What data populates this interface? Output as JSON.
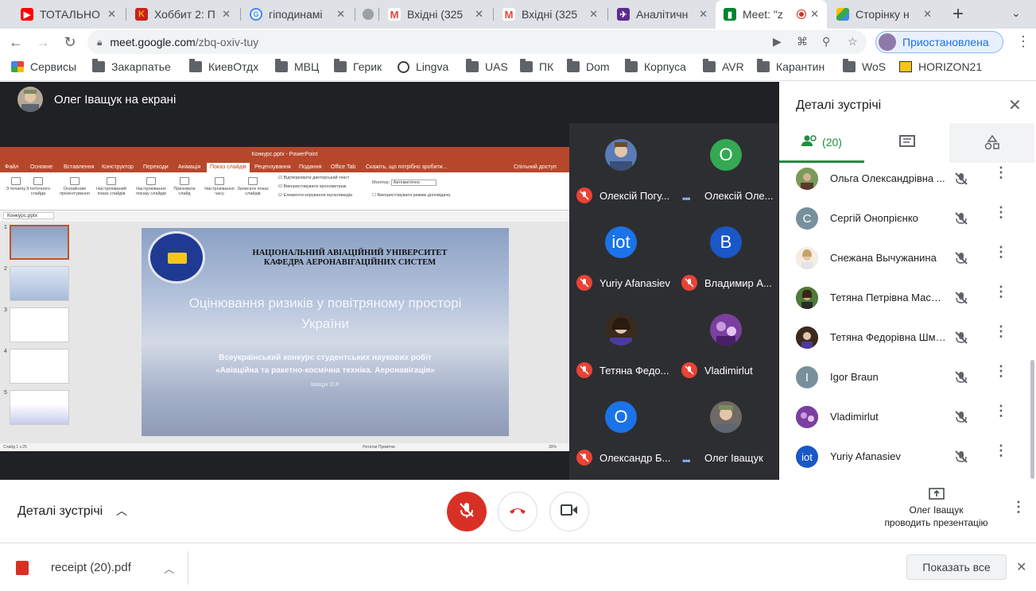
{
  "browser": {
    "tabs": [
      {
        "title": "ТОТАЛЬНО",
        "favicon": "youtube-icon",
        "color": "#ff0000"
      },
      {
        "title": "Хоббит 2: П",
        "favicon": "k-icon",
        "color": "#e8710a"
      },
      {
        "title": "гіподинамі",
        "favicon": "google-icon",
        "color": "#4285f4"
      },
      {
        "title": "",
        "favicon": "loading-icon",
        "color": "#9aa0a6"
      },
      {
        "title": "Вхідні (325",
        "favicon": "gmail-icon",
        "color": "#ea4335"
      },
      {
        "title": "Вхідні (325",
        "favicon": "gmail-icon",
        "color": "#ea4335"
      },
      {
        "title": "Аналітичн",
        "favicon": "plane-icon",
        "color": "#5b2a8f"
      },
      {
        "title": "Meet: \"z",
        "favicon": "meet-icon",
        "color": "#00832d",
        "active": true
      },
      {
        "title": "Сторінку н",
        "favicon": "drive-icon",
        "color": "#fbbc04"
      }
    ],
    "url_host": "meet.google.com",
    "url_path": "/zbq-oxiv-tuy",
    "profile_label": "Приостановлена",
    "bookmarks": [
      {
        "label": "Сервисы",
        "icon": "apps-icon"
      },
      {
        "label": "Закарпатье",
        "icon": "folder-icon"
      },
      {
        "label": "КиевОтдх",
        "icon": "folder-icon"
      },
      {
        "label": "МВЦ",
        "icon": "folder-icon"
      },
      {
        "label": "Герик",
        "icon": "folder-icon"
      },
      {
        "label": "Lingva",
        "icon": "globe-icon"
      },
      {
        "label": "UAS",
        "icon": "folder-icon"
      },
      {
        "label": "ПК",
        "icon": "folder-icon"
      },
      {
        "label": "Dom",
        "icon": "folder-icon"
      },
      {
        "label": "Корпуса",
        "icon": "folder-icon"
      },
      {
        "label": "AVR",
        "icon": "folder-icon"
      },
      {
        "label": "Карантин",
        "icon": "folder-icon"
      },
      {
        "label": "WoS",
        "icon": "folder-icon"
      },
      {
        "label": "HORIZON21",
        "icon": "horizon-icon"
      }
    ]
  },
  "meet": {
    "presenter_label": "Олег Іващук на екрані",
    "ppt": {
      "window_title": "Конкурс.pptx - PowerPoint",
      "menu": [
        "Файл",
        "Основне",
        "Вставлення",
        "Конструктор",
        "Переходи",
        "Анімація",
        "Показ слайдів",
        "Рецензування",
        "Подання",
        "Office Tab",
        "Скажіть, що потрібно зробити...",
        "Спільний доступ"
      ],
      "ribbon": [
        "З початку",
        "З поточного слайда",
        "Онлайнове презентування",
        "Настроюваний показ слайдів",
        "Настроювання показу слайдів",
        "Приховати слайд",
        "Настроювання часу",
        "Записати показ слайдів"
      ],
      "checks": [
        "Відтворювати дикторський текст",
        "Використовувати хронометраж",
        "Елементи керування мультимедіа"
      ],
      "monitor_label": "Монітор:",
      "monitor_value": "Автоматично",
      "presenter_view": "Використовувати режим доповідача",
      "file_tab": "Конкурс.pptx",
      "status_left": "Слайд 1 з 25",
      "status_right": "Нотатки   Примітки",
      "zoom": "39%",
      "slide": {
        "header1": "НАЦІОНАЛЬНИЙ АВІАЦІЙНИЙ УНІВЕРСИТЕТ",
        "header2": "КАФЕДРА АЕРОНАВІГАЦІЙНИХ СИСТЕМ",
        "title1": "Оцінювання ризиків у повітряному просторі",
        "title2": "України",
        "sub1": "Всеукраїнський конкурс студентських наукових робіт",
        "sub2": "«Авіаційна та ракетно-космічна техніка. Аеронавігація»",
        "author": "Іващук О.Р."
      }
    },
    "tiles": [
      {
        "name": "Олексій Погу...",
        "avatar": "photo",
        "color": "#5a7bb5",
        "state": "muted"
      },
      {
        "name": "Олексій Оле...",
        "avatar": "О",
        "color": "#34a853",
        "state": "speaking"
      },
      {
        "name": "Yuriy Afanasiev",
        "avatar": "iot",
        "color": "#1a73e8",
        "state": "muted"
      },
      {
        "name": "Владимир А...",
        "avatar": "В",
        "color": "#1a57c7",
        "state": "muted"
      },
      {
        "name": "Тетяна Федо...",
        "avatar": "photo",
        "color": "#3a2a1e",
        "state": "muted"
      },
      {
        "name": "Vladimirlut",
        "avatar": "photo",
        "color": "#7b3fa0",
        "state": "muted"
      },
      {
        "name": "Олександр Б...",
        "avatar": "О",
        "color": "#1a73e8",
        "state": "muted"
      },
      {
        "name": "Олег Іващук",
        "avatar": "photo",
        "color": "#6f6a65",
        "state": "speaking"
      }
    ],
    "panel": {
      "title": "Деталі зустрічі",
      "people_count": "(20)",
      "people": [
        {
          "name": "Ольга Олександрівна ...",
          "avatar": "photo",
          "color": "#6b8f4e"
        },
        {
          "name": "Сергій Онопрієнко",
          "avatar": "С",
          "color": "#78909c"
        },
        {
          "name": "Снежана Вычужанина",
          "avatar": "photo",
          "color": "#f0d5b8"
        },
        {
          "name": "Тетяна Петрівна Маслак",
          "avatar": "photo",
          "color": "#7a5b3e"
        },
        {
          "name": "Тетяна Федорівна Шме...",
          "avatar": "photo",
          "color": "#3a2a1e"
        },
        {
          "name": "Igor Braun",
          "avatar": "I",
          "color": "#78909c"
        },
        {
          "name": "Vladimirlut",
          "avatar": "photo",
          "color": "#7b3fa0"
        },
        {
          "name": "Yuriy Afanasiev",
          "avatar": "iot",
          "color": "#1a57c7"
        }
      ]
    },
    "controls": {
      "details_label": "Деталі зустрічі",
      "presenting_name": "Олег Іващук",
      "presenting_text": "проводить презентацію"
    }
  },
  "downloads": {
    "file_name": "receipt (20).pdf",
    "show_all": "Показать все"
  }
}
